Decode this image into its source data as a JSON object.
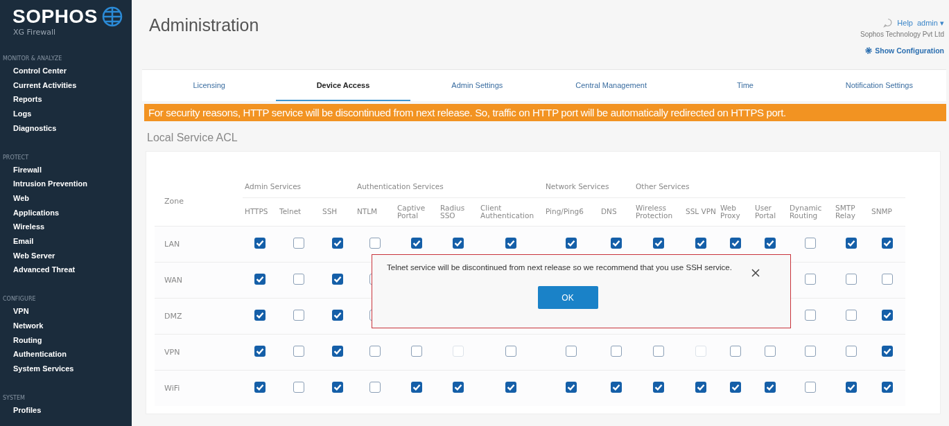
{
  "sidebar": {
    "logo": "SOPHOS",
    "product": "XG Firewall",
    "sections": [
      {
        "heading": "MONITOR & ANALYZE",
        "items": [
          "Control Center",
          "Current Activities",
          "Reports",
          "Logs",
          "Diagnostics"
        ]
      },
      {
        "heading": "PROTECT",
        "items": [
          "Firewall",
          "Intrusion Prevention",
          "Web",
          "Applications",
          "Wireless",
          "Email",
          "Web Server",
          "Advanced Threat"
        ]
      },
      {
        "heading": "CONFIGURE",
        "items": [
          "VPN",
          "Network",
          "Routing",
          "Authentication",
          "System Services"
        ]
      },
      {
        "heading": "SYSTEM",
        "items": [
          "Profiles"
        ]
      }
    ]
  },
  "header": {
    "title": "Administration",
    "help": "Help",
    "user": "admin",
    "user_caret": "▾",
    "company": "Sophos Technology Pvt Ltd",
    "show_configuration": "Show Configuration"
  },
  "tabs": [
    {
      "label": "Licensing",
      "selected": false
    },
    {
      "label": "Device Access",
      "selected": true
    },
    {
      "label": "Admin Settings",
      "selected": false
    },
    {
      "label": "Central Management",
      "selected": false
    },
    {
      "label": "Time",
      "selected": false
    },
    {
      "label": "Notification Settings",
      "selected": false
    }
  ],
  "banner": "For security reasons, HTTP service will be discontinued from next release. So, traffic on HTTP port will be automatically redirected on HTTPS port.",
  "section_title": "Local Service ACL",
  "table": {
    "zone_heading": "Zone",
    "groups": [
      {
        "label": "Admin Services",
        "columns": [
          "HTTPS",
          "Telnet",
          "SSH"
        ]
      },
      {
        "label": "Authentication Services",
        "columns": [
          "NTLM",
          "Captive Portal",
          "Radius SSO",
          "Client Authentication"
        ]
      },
      {
        "label": "Network Services",
        "columns": [
          "Ping/Ping6",
          "DNS"
        ]
      },
      {
        "label": "Other Services",
        "columns": [
          "Wireless Protection",
          "SSL VPN",
          "Web Proxy",
          "User Portal",
          "Dynamic Routing",
          "SMTP Relay",
          "SNMP"
        ]
      }
    ],
    "rows": [
      {
        "zone": "LAN",
        "cells": [
          {
            "checked": true,
            "disabled": false
          },
          {
            "checked": false,
            "disabled": false
          },
          {
            "checked": true,
            "disabled": false
          },
          {
            "checked": false,
            "disabled": false
          },
          {
            "checked": true,
            "disabled": false
          },
          {
            "checked": true,
            "disabled": false
          },
          {
            "checked": true,
            "disabled": false
          },
          {
            "checked": true,
            "disabled": false
          },
          {
            "checked": true,
            "disabled": false
          },
          {
            "checked": true,
            "disabled": false
          },
          {
            "checked": true,
            "disabled": false
          },
          {
            "checked": true,
            "disabled": false
          },
          {
            "checked": true,
            "disabled": false
          },
          {
            "checked": false,
            "disabled": false
          },
          {
            "checked": true,
            "disabled": false
          },
          {
            "checked": true,
            "disabled": false
          }
        ]
      },
      {
        "zone": "WAN",
        "cells": [
          {
            "checked": true,
            "disabled": false
          },
          {
            "checked": false,
            "disabled": false
          },
          {
            "checked": true,
            "disabled": false
          },
          {
            "checked": false,
            "disabled": false
          },
          null,
          null,
          null,
          null,
          null,
          null,
          null,
          null,
          null,
          {
            "checked": false,
            "disabled": false
          },
          {
            "checked": false,
            "disabled": false
          },
          {
            "checked": false,
            "disabled": false
          }
        ]
      },
      {
        "zone": "DMZ",
        "cells": [
          {
            "checked": true,
            "disabled": false
          },
          {
            "checked": false,
            "disabled": false
          },
          {
            "checked": true,
            "disabled": false
          },
          {
            "checked": false,
            "disabled": false
          },
          null,
          null,
          null,
          null,
          null,
          null,
          null,
          null,
          null,
          {
            "checked": false,
            "disabled": false
          },
          {
            "checked": false,
            "disabled": false
          },
          {
            "checked": true,
            "disabled": false
          }
        ]
      },
      {
        "zone": "VPN",
        "cells": [
          {
            "checked": true,
            "disabled": false
          },
          {
            "checked": false,
            "disabled": false
          },
          {
            "checked": true,
            "disabled": false
          },
          {
            "checked": false,
            "disabled": false
          },
          {
            "checked": false,
            "disabled": false
          },
          {
            "checked": false,
            "disabled": true
          },
          {
            "checked": false,
            "disabled": false
          },
          {
            "checked": false,
            "disabled": false
          },
          {
            "checked": false,
            "disabled": false
          },
          {
            "checked": false,
            "disabled": false
          },
          {
            "checked": false,
            "disabled": true
          },
          {
            "checked": false,
            "disabled": false
          },
          {
            "checked": false,
            "disabled": false
          },
          {
            "checked": false,
            "disabled": false
          },
          {
            "checked": false,
            "disabled": false
          },
          {
            "checked": true,
            "disabled": false
          }
        ]
      },
      {
        "zone": "WiFi",
        "cells": [
          {
            "checked": true,
            "disabled": false
          },
          {
            "checked": false,
            "disabled": false
          },
          {
            "checked": true,
            "disabled": false
          },
          {
            "checked": false,
            "disabled": false
          },
          {
            "checked": true,
            "disabled": false
          },
          {
            "checked": true,
            "disabled": false
          },
          {
            "checked": true,
            "disabled": false
          },
          {
            "checked": true,
            "disabled": false
          },
          {
            "checked": true,
            "disabled": false
          },
          {
            "checked": true,
            "disabled": false
          },
          {
            "checked": true,
            "disabled": false
          },
          {
            "checked": true,
            "disabled": false
          },
          {
            "checked": true,
            "disabled": false
          },
          {
            "checked": false,
            "disabled": false
          },
          {
            "checked": true,
            "disabled": false
          },
          {
            "checked": true,
            "disabled": false
          }
        ]
      }
    ]
  },
  "dialog": {
    "message": "Telnet service will be discontinued from next release so we recommend that you use SSH service.",
    "button": "OK"
  }
}
